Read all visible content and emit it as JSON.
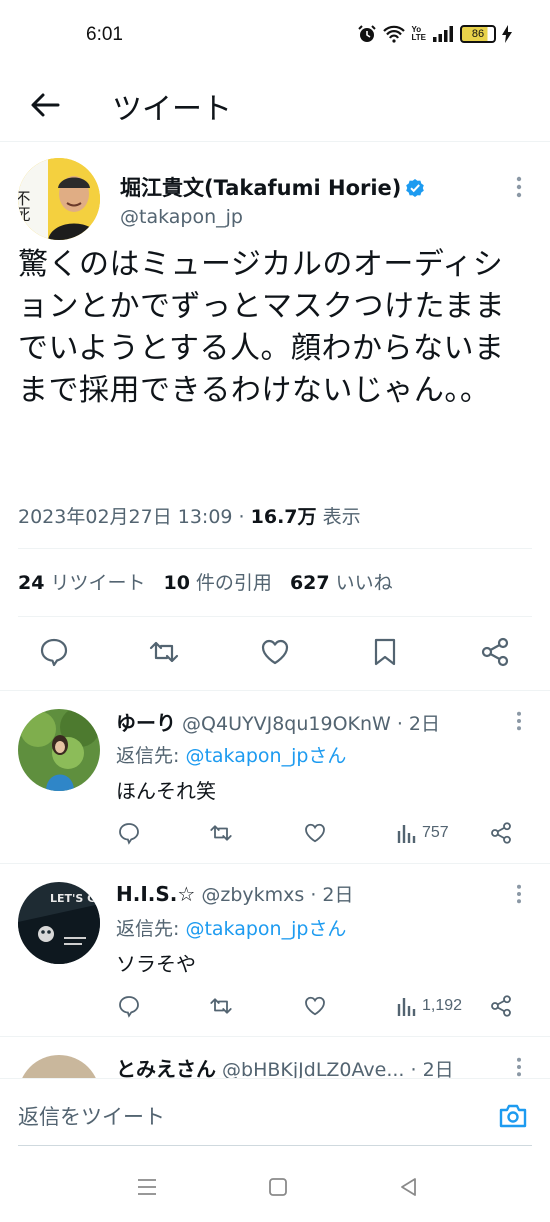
{
  "status": {
    "time": "6:01",
    "battery": "86",
    "volte": "Yo LTE"
  },
  "header": {
    "title": "ツイート"
  },
  "tweet": {
    "display_name": "堀江貴文(Takafumi Horie)",
    "handle": "@takapon_jp",
    "text": "驚くのはミュージカルのオーディションとかでずっとマスクつけたままでいようとする人。顔わからないままで採用できるわけないじゃん。。",
    "timestamp": "2023年02月27日 13:09",
    "views_count": "16.7万",
    "views_label": "表示",
    "avatar_book_text": "不死の研究",
    "retweets_count": "24",
    "retweets_label": "リツイート",
    "quotes_count": "10",
    "quotes_label": "件の引用",
    "likes_count": "627",
    "likes_label": "いいね"
  },
  "replies": [
    {
      "name": "ゆーり",
      "handle_time": "@Q4UYVJ8qu19OKnW · 2日",
      "reply_to_prefix": "返信先: ",
      "reply_to_handle": "@takapon_jpさん",
      "body": "ほんそれ笑",
      "views": "757"
    },
    {
      "name": "H.I.S.☆",
      "handle_time": "@zbykmxs · 2日",
      "reply_to_prefix": "返信先: ",
      "reply_to_handle": "@takapon_jpさん",
      "body": "ソラそや",
      "views": "1,192",
      "avatar_text": "LET'S GO"
    },
    {
      "name": "とみえさん",
      "handle_time": "@bHBKjJdLZ0Ave... · 2日"
    }
  ],
  "composer": {
    "placeholder": "返信をツイート"
  },
  "colors": {
    "accent": "#1d9bf0",
    "text": "#0f1419",
    "muted": "#536471"
  }
}
